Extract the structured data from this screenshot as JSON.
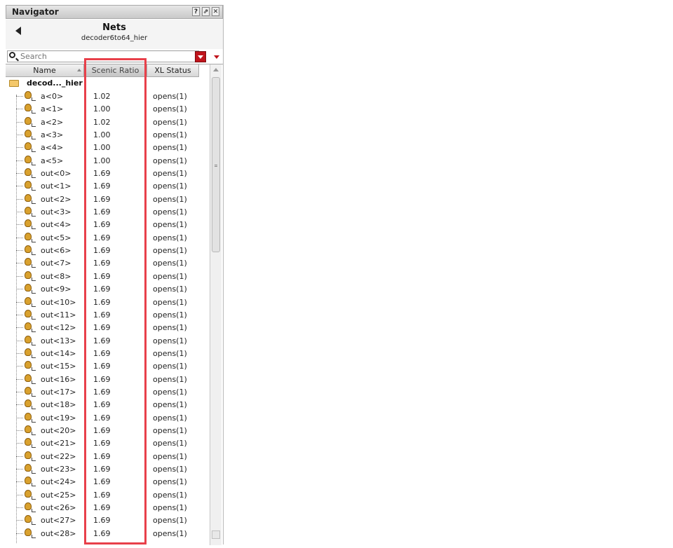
{
  "window": {
    "title": "Navigator",
    "buttons": [
      "?",
      "⇗",
      "✕"
    ]
  },
  "header": {
    "title": "Nets",
    "subtitle": "decoder6to64_hier"
  },
  "search": {
    "placeholder": "Search",
    "value": ""
  },
  "columns": [
    "Name",
    "Scenic Ratio",
    "XL Status"
  ],
  "root": {
    "label": "decod..._hier"
  },
  "rows": [
    {
      "name": "a<0>",
      "ratio": "1.02",
      "xl": "opens(1)"
    },
    {
      "name": "a<1>",
      "ratio": "1.00",
      "xl": "opens(1)"
    },
    {
      "name": "a<2>",
      "ratio": "1.02",
      "xl": "opens(1)"
    },
    {
      "name": "a<3>",
      "ratio": "1.00",
      "xl": "opens(1)"
    },
    {
      "name": "a<4>",
      "ratio": "1.00",
      "xl": "opens(1)"
    },
    {
      "name": "a<5>",
      "ratio": "1.00",
      "xl": "opens(1)"
    },
    {
      "name": "out<0>",
      "ratio": "1.69",
      "xl": "opens(1)"
    },
    {
      "name": "out<1>",
      "ratio": "1.69",
      "xl": "opens(1)"
    },
    {
      "name": "out<2>",
      "ratio": "1.69",
      "xl": "opens(1)"
    },
    {
      "name": "out<3>",
      "ratio": "1.69",
      "xl": "opens(1)"
    },
    {
      "name": "out<4>",
      "ratio": "1.69",
      "xl": "opens(1)"
    },
    {
      "name": "out<5>",
      "ratio": "1.69",
      "xl": "opens(1)"
    },
    {
      "name": "out<6>",
      "ratio": "1.69",
      "xl": "opens(1)"
    },
    {
      "name": "out<7>",
      "ratio": "1.69",
      "xl": "opens(1)"
    },
    {
      "name": "out<8>",
      "ratio": "1.69",
      "xl": "opens(1)"
    },
    {
      "name": "out<9>",
      "ratio": "1.69",
      "xl": "opens(1)"
    },
    {
      "name": "out<10>",
      "ratio": "1.69",
      "xl": "opens(1)"
    },
    {
      "name": "out<11>",
      "ratio": "1.69",
      "xl": "opens(1)"
    },
    {
      "name": "out<12>",
      "ratio": "1.69",
      "xl": "opens(1)"
    },
    {
      "name": "out<13>",
      "ratio": "1.69",
      "xl": "opens(1)"
    },
    {
      "name": "out<14>",
      "ratio": "1.69",
      "xl": "opens(1)"
    },
    {
      "name": "out<15>",
      "ratio": "1.69",
      "xl": "opens(1)"
    },
    {
      "name": "out<16>",
      "ratio": "1.69",
      "xl": "opens(1)"
    },
    {
      "name": "out<17>",
      "ratio": "1.69",
      "xl": "opens(1)"
    },
    {
      "name": "out<18>",
      "ratio": "1.69",
      "xl": "opens(1)"
    },
    {
      "name": "out<19>",
      "ratio": "1.69",
      "xl": "opens(1)"
    },
    {
      "name": "out<20>",
      "ratio": "1.69",
      "xl": "opens(1)"
    },
    {
      "name": "out<21>",
      "ratio": "1.69",
      "xl": "opens(1)"
    },
    {
      "name": "out<22>",
      "ratio": "1.69",
      "xl": "opens(1)"
    },
    {
      "name": "out<23>",
      "ratio": "1.69",
      "xl": "opens(1)"
    },
    {
      "name": "out<24>",
      "ratio": "1.69",
      "xl": "opens(1)"
    },
    {
      "name": "out<25>",
      "ratio": "1.69",
      "xl": "opens(1)"
    },
    {
      "name": "out<26>",
      "ratio": "1.69",
      "xl": "opens(1)"
    },
    {
      "name": "out<27>",
      "ratio": "1.69",
      "xl": "opens(1)"
    },
    {
      "name": "out<28>",
      "ratio": "1.69",
      "xl": "opens(1)"
    }
  ],
  "colors": {
    "accent": "#c0141c",
    "highlight": "#e8404a",
    "net_icon": "#d9a12e",
    "folder": "#f4c86b"
  },
  "icons": {
    "back": "back-arrow-icon",
    "search": "search-icon",
    "filter": "filter-dropdown-icon",
    "net": "net-icon",
    "folder": "folder-icon"
  }
}
